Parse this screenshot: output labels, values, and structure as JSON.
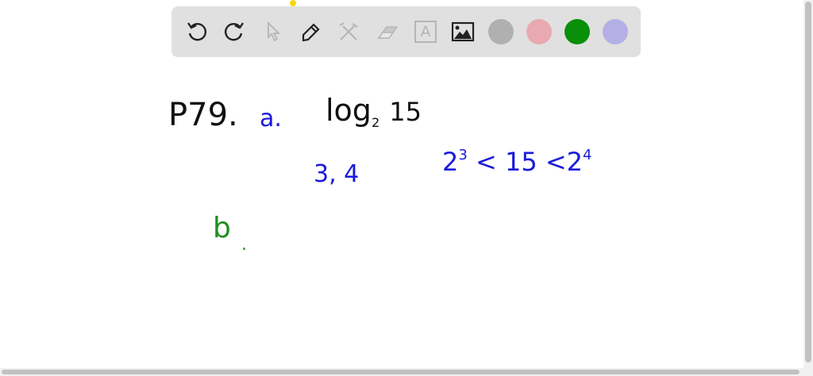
{
  "toolbar": {
    "tools": [
      {
        "name": "undo-icon",
        "enabled": true
      },
      {
        "name": "redo-icon",
        "enabled": true
      },
      {
        "name": "select-pointer-icon",
        "enabled": false
      },
      {
        "name": "pen-icon",
        "enabled": true
      },
      {
        "name": "tools-icon",
        "enabled": false
      },
      {
        "name": "eraser-icon",
        "enabled": false
      },
      {
        "name": "text-icon",
        "enabled": false
      },
      {
        "name": "image-icon",
        "enabled": true
      }
    ],
    "text_tool_glyph": "A",
    "colors": [
      "#b0b0b0",
      "#e8a9b0",
      "#0a8f0a",
      "#b4b0e6"
    ]
  },
  "canvas": {
    "problem_label": "P79.",
    "part_a_label": "a.",
    "log_expr": {
      "base_word": "log",
      "base": "2",
      "argument": "15"
    },
    "bounds": "3, 4",
    "inequality": {
      "left_base": "2",
      "left_exp": "3",
      "lt1": "<",
      "middle": "15",
      "lt2": "<",
      "right_base": "2",
      "right_exp": "4"
    },
    "part_b_label": "b",
    "part_b_dot": "."
  },
  "ink_colors": {
    "black": "#111111",
    "blue": "#1a1adc",
    "green": "#1f8f1f"
  }
}
